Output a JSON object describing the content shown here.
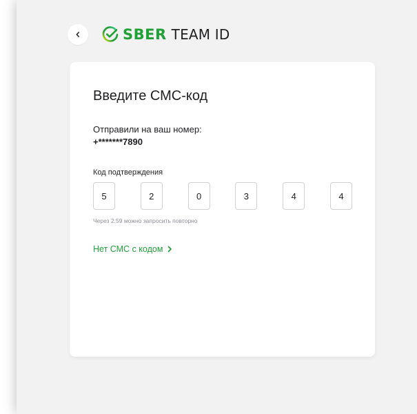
{
  "header": {
    "back_icon": "chevron-left-icon",
    "logo_icon": "sber-check-circle-icon",
    "brand_name": "SBER",
    "product_name": "TEAM ID",
    "brand_color": "#21a038"
  },
  "card": {
    "title": "Введите СМС-код",
    "sent_label": "Отправили на ваш номер:",
    "phone": "+*******7890",
    "code_label": "Код подтверждения",
    "digits": [
      "5",
      "2",
      "0",
      "3",
      "4",
      "4"
    ],
    "resend_text": "Через 2:59 можно запросить повторно",
    "no_sms_link": "Нет СМС с кодом",
    "no_sms_icon": "chevron-right-icon"
  }
}
